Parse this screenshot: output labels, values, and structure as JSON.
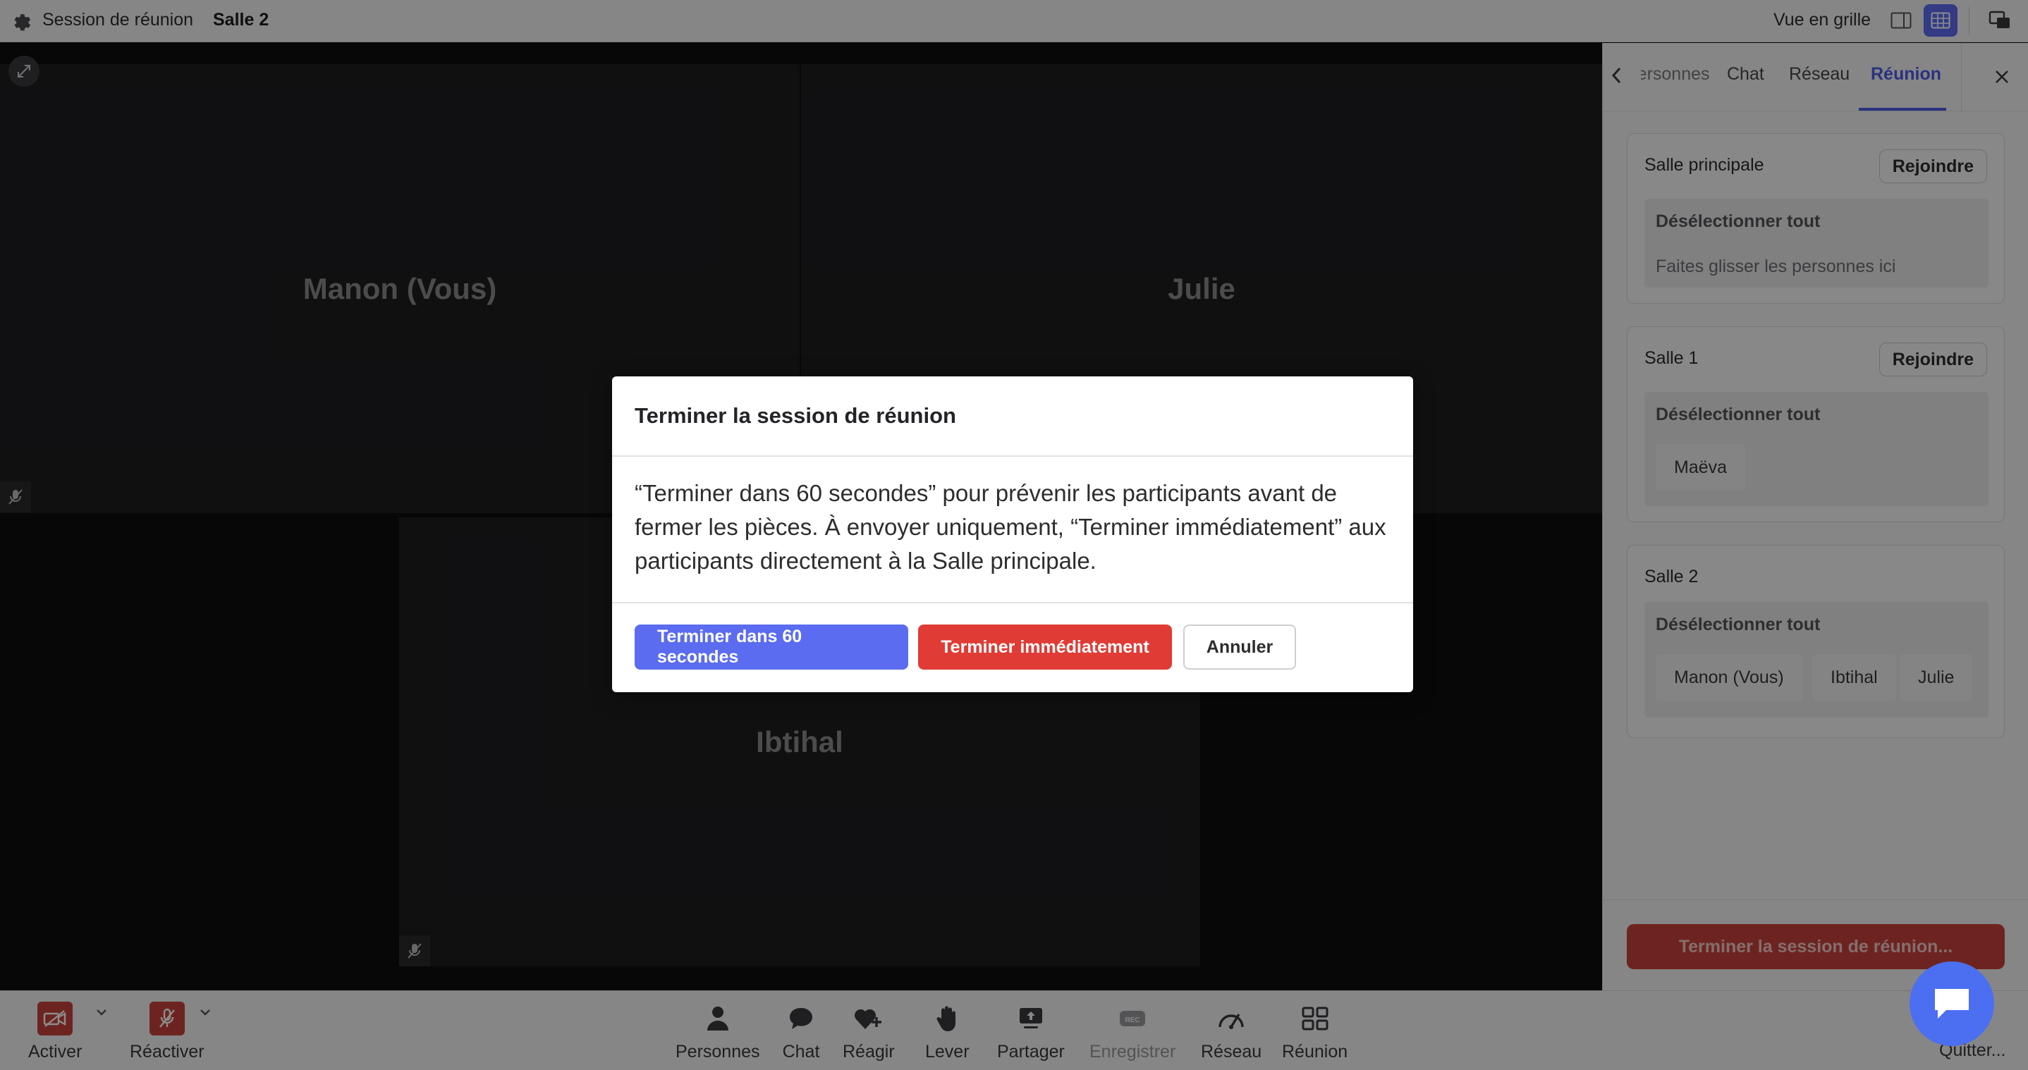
{
  "topbar": {
    "session_label": "Session de réunion",
    "room_label": "Salle 2",
    "view_label": "Vue en grille"
  },
  "tiles": [
    {
      "name": "Manon (Vous)"
    },
    {
      "name": "Julie"
    },
    {
      "name": "Ibtihal"
    }
  ],
  "panel": {
    "tabs": [
      {
        "label": "Personnes"
      },
      {
        "label": "Chat"
      },
      {
        "label": "Réseau"
      },
      {
        "label": "Réunion",
        "active": true
      }
    ],
    "rooms": [
      {
        "title": "Salle principale",
        "join": "Rejoindre",
        "deselect": "Désélectionner tout",
        "hint": "Faites glisser les personnes ici",
        "people": []
      },
      {
        "title": "Salle 1",
        "join": "Rejoindre",
        "deselect": "Désélectionner tout",
        "people": [
          "Maëva"
        ]
      },
      {
        "title": "Salle 2",
        "deselect": "Désélectionner tout",
        "people": [
          "Manon (Vous)",
          "Ibtihal",
          "Julie"
        ]
      }
    ],
    "end_session_button": "Terminer la session de réunion..."
  },
  "bottombar": {
    "controls": [
      {
        "label": "Activer",
        "icon": "camera-off-icon"
      },
      {
        "label": "Réactiver",
        "icon": "mic-off-icon"
      },
      {
        "label": "Personnes",
        "icon": "person-icon"
      },
      {
        "label": "Chat",
        "icon": "chat-bubble-icon"
      },
      {
        "label": "Réagir",
        "icon": "heart-plus-icon"
      },
      {
        "label": "Lever",
        "icon": "raise-hand-icon"
      },
      {
        "label": "Partager",
        "icon": "share-screen-icon"
      },
      {
        "label": "Enregistrer",
        "icon": "record-icon",
        "disabled": true
      },
      {
        "label": "Réseau",
        "icon": "network-gauge-icon"
      },
      {
        "label": "Réunion",
        "icon": "breakout-grid-icon"
      }
    ],
    "quit_label": "Quitter..."
  },
  "modal": {
    "title": "Terminer la session de réunion",
    "body": "“Terminer dans 60 secondes” pour prévenir les participants avant de fermer les pièces. À envoyer uniquement, “Terminer immédiatement” aux participants directement à la Salle principale.",
    "primary_button": "Terminer dans 60 secondes",
    "danger_button": "Terminer immédiatement",
    "cancel_button": "Annuler"
  },
  "colors": {
    "accent": "#5b6cf0",
    "danger": "#e03b35",
    "muted_red": "#c6433b",
    "chat_fab": "#4b6ff0"
  }
}
